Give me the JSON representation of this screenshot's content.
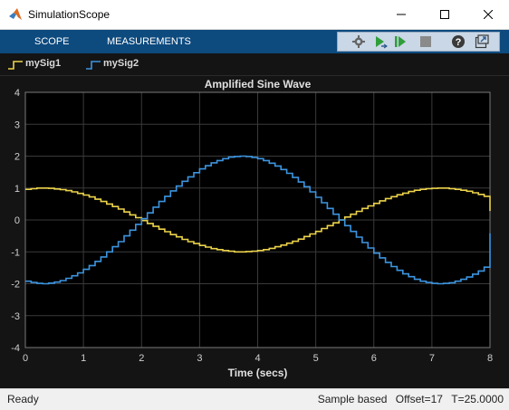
{
  "window": {
    "title": "SimulationScope"
  },
  "toolstrip": {
    "tabs": [
      {
        "label": "SCOPE"
      },
      {
        "label": "MEASUREMENTS"
      }
    ],
    "buttons": [
      {
        "name": "settings-icon"
      },
      {
        "name": "step-forward-icon"
      },
      {
        "name": "run-icon"
      },
      {
        "name": "stop-icon"
      },
      {
        "name": "help-icon"
      },
      {
        "name": "undock-icon"
      }
    ]
  },
  "legend": [
    {
      "label": "mySig1",
      "color": "#ecd34a"
    },
    {
      "label": "mySig2",
      "color": "#3c95e0"
    }
  ],
  "status": {
    "ready": "Ready",
    "mode": "Sample based",
    "offset": "Offset=17",
    "time": "T=25.0000"
  },
  "chart_data": {
    "type": "line",
    "title": "Amplified Sine Wave",
    "xlabel": "Time (secs)",
    "ylabel": "",
    "xlim": [
      0,
      8
    ],
    "ylim": [
      -4,
      4
    ],
    "xticks": [
      0,
      1,
      2,
      3,
      4,
      5,
      6,
      7,
      8
    ],
    "yticks": [
      -4,
      -3,
      -2,
      -1,
      0,
      1,
      2,
      3,
      4
    ],
    "grid": true,
    "step": 0.1,
    "style": "stairs",
    "series": [
      {
        "name": "mySig1",
        "color": "#ecd34a",
        "x": [
          0.0,
          0.1,
          0.2,
          0.3,
          0.4,
          0.5,
          0.6,
          0.7,
          0.8,
          0.9,
          1.0,
          1.1,
          1.2,
          1.3,
          1.4,
          1.5,
          1.6,
          1.7,
          1.8,
          1.9,
          2.0,
          2.1,
          2.2,
          2.3,
          2.4,
          2.5,
          2.6,
          2.7,
          2.8,
          2.9,
          3.0,
          3.1,
          3.2,
          3.3,
          3.4,
          3.5,
          3.6,
          3.7,
          3.8,
          3.9,
          4.0,
          4.1,
          4.2,
          4.3,
          4.4,
          4.5,
          4.6,
          4.7,
          4.8,
          4.9,
          5.0,
          5.1,
          5.2,
          5.3,
          5.4,
          5.5,
          5.6,
          5.7,
          5.8,
          5.9,
          6.0,
          6.1,
          6.2,
          6.3,
          6.4,
          6.5,
          6.6,
          6.7,
          6.8,
          6.9,
          7.0,
          7.1,
          7.2,
          7.3,
          7.4,
          7.5,
          7.6,
          7.7,
          7.8,
          7.9,
          8.0
        ],
        "y": [
          0.96,
          0.98,
          1.0,
          1.0,
          0.99,
          0.97,
          0.95,
          0.92,
          0.88,
          0.83,
          0.78,
          0.72,
          0.65,
          0.58,
          0.5,
          0.42,
          0.34,
          0.25,
          0.16,
          0.07,
          -0.02,
          -0.11,
          -0.2,
          -0.29,
          -0.37,
          -0.46,
          -0.53,
          -0.61,
          -0.68,
          -0.74,
          -0.8,
          -0.85,
          -0.9,
          -0.93,
          -0.96,
          -0.98,
          -1.0,
          -1.0,
          -0.99,
          -0.98,
          -0.96,
          -0.93,
          -0.89,
          -0.84,
          -0.79,
          -0.73,
          -0.67,
          -0.6,
          -0.52,
          -0.44,
          -0.36,
          -0.27,
          -0.18,
          -0.09,
          0.0,
          0.09,
          0.18,
          0.27,
          0.36,
          0.44,
          0.52,
          0.6,
          0.67,
          0.73,
          0.79,
          0.84,
          0.89,
          0.93,
          0.96,
          0.98,
          0.99,
          1.0,
          1.0,
          0.98,
          0.96,
          0.93,
          0.9,
          0.85,
          0.8,
          0.74,
          0.28
        ]
      },
      {
        "name": "mySig2",
        "color": "#3c95e0",
        "x": [
          0.0,
          0.1,
          0.2,
          0.3,
          0.4,
          0.5,
          0.6,
          0.7,
          0.8,
          0.9,
          1.0,
          1.1,
          1.2,
          1.3,
          1.4,
          1.5,
          1.6,
          1.7,
          1.8,
          1.9,
          2.0,
          2.1,
          2.2,
          2.3,
          2.4,
          2.5,
          2.6,
          2.7,
          2.8,
          2.9,
          3.0,
          3.1,
          3.2,
          3.3,
          3.4,
          3.5,
          3.6,
          3.7,
          3.8,
          3.9,
          4.0,
          4.1,
          4.2,
          4.3,
          4.4,
          4.5,
          4.6,
          4.7,
          4.8,
          4.9,
          5.0,
          5.1,
          5.2,
          5.3,
          5.4,
          5.5,
          5.6,
          5.7,
          5.8,
          5.9,
          6.0,
          6.1,
          6.2,
          6.3,
          6.4,
          6.5,
          6.6,
          6.7,
          6.8,
          6.9,
          7.0,
          7.1,
          7.2,
          7.3,
          7.4,
          7.5,
          7.6,
          7.7,
          7.8,
          7.9,
          8.0
        ],
        "y": [
          -1.92,
          -1.96,
          -1.99,
          -2.0,
          -1.98,
          -1.95,
          -1.9,
          -1.83,
          -1.75,
          -1.66,
          -1.55,
          -1.43,
          -1.3,
          -1.16,
          -1.0,
          -0.84,
          -0.68,
          -0.5,
          -0.32,
          -0.14,
          0.04,
          0.22,
          0.4,
          0.58,
          0.74,
          0.91,
          1.06,
          1.21,
          1.35,
          1.48,
          1.6,
          1.7,
          1.79,
          1.86,
          1.92,
          1.97,
          1.99,
          2.0,
          1.99,
          1.96,
          1.92,
          1.86,
          1.78,
          1.69,
          1.58,
          1.46,
          1.33,
          1.19,
          1.04,
          0.88,
          0.71,
          0.54,
          0.36,
          0.18,
          0.0,
          -0.18,
          -0.36,
          -0.54,
          -0.71,
          -0.88,
          -1.04,
          -1.19,
          -1.33,
          -1.46,
          -1.58,
          -1.69,
          -1.78,
          -1.86,
          -1.92,
          -1.96,
          -1.99,
          -2.0,
          -1.99,
          -1.97,
          -1.92,
          -1.86,
          -1.79,
          -1.7,
          -1.6,
          -1.48,
          -0.42
        ]
      }
    ]
  }
}
